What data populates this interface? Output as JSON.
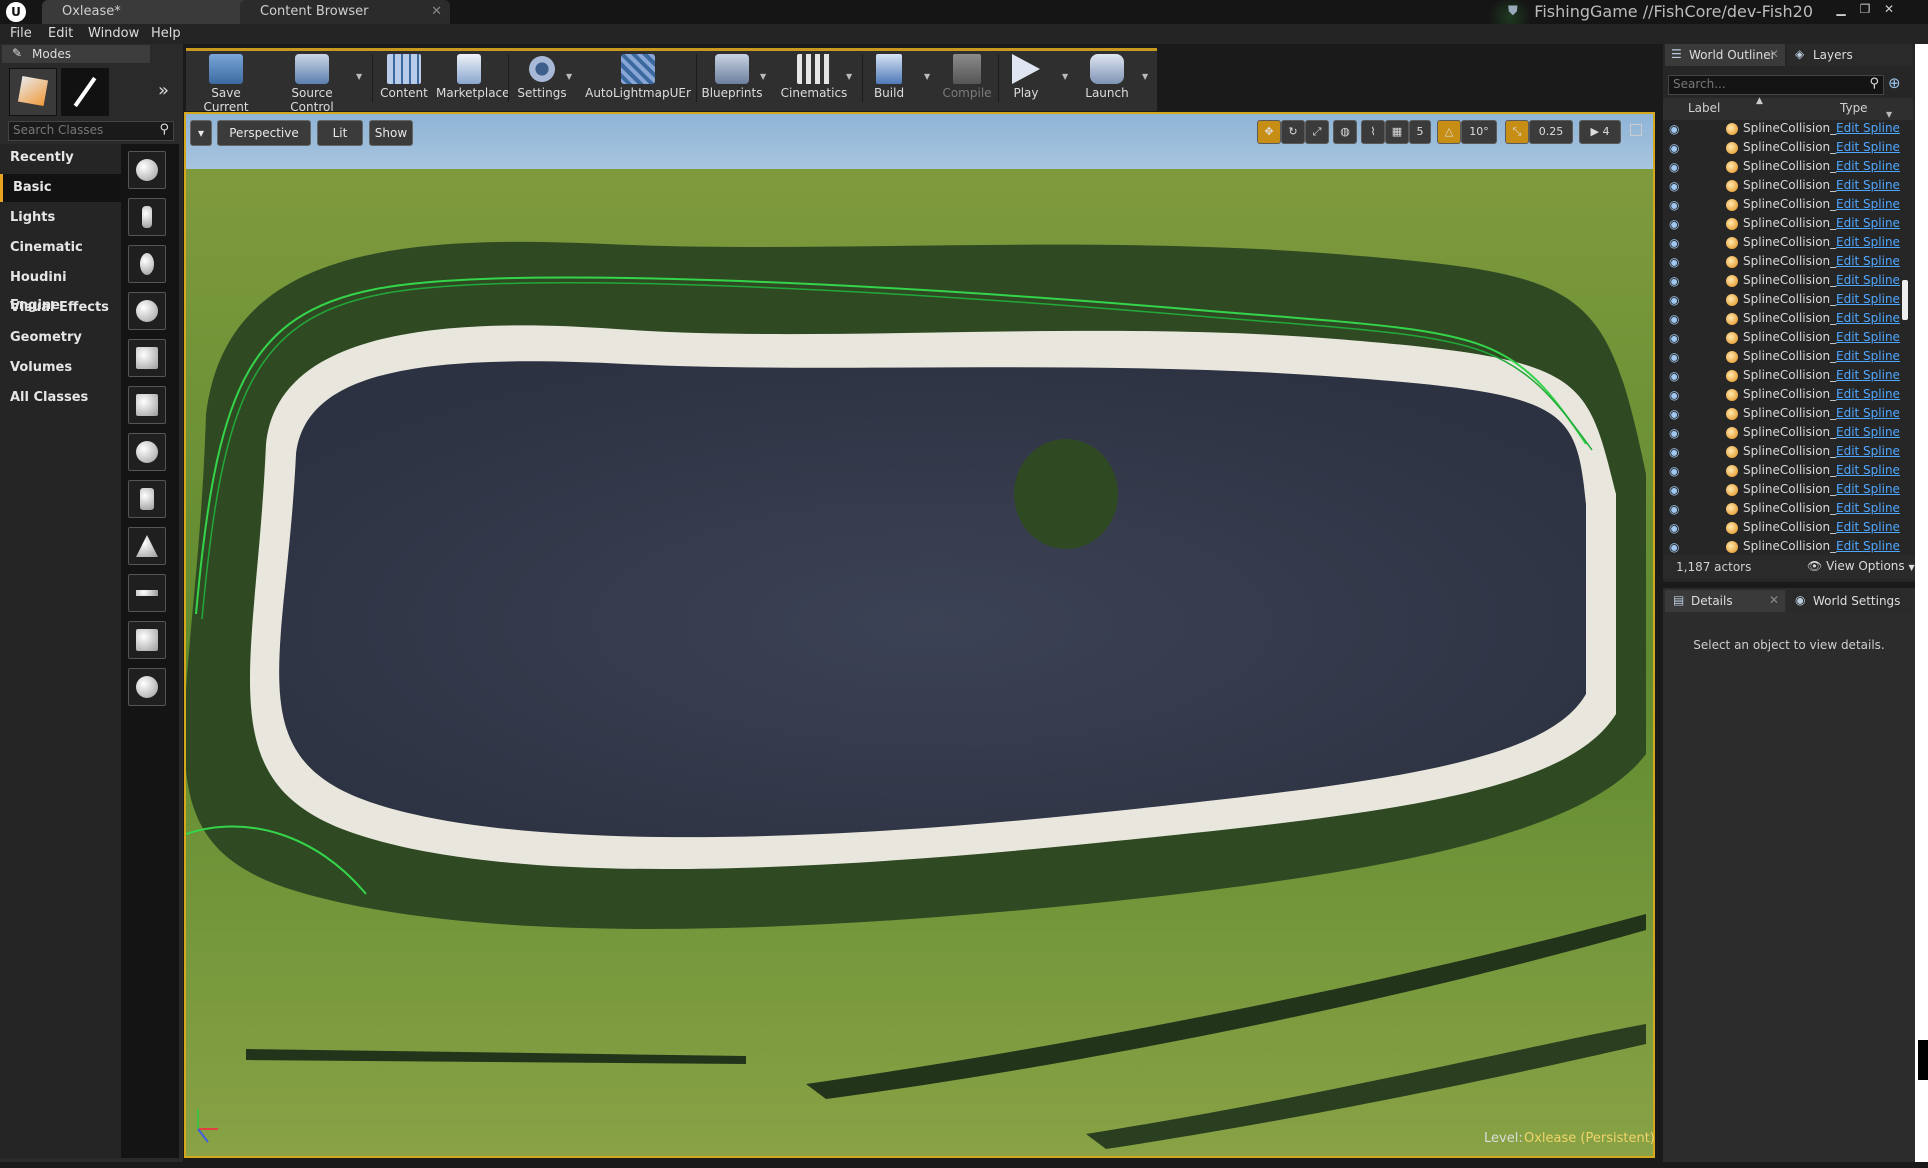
{
  "titlebar": {
    "logo": "U",
    "tabs": [
      {
        "label": "Oxlease*"
      },
      {
        "label": "Content Browser"
      }
    ],
    "project": "FishingGame //FishCore/dev-Fish20",
    "window_controls": [
      "minimize-icon",
      "restore-icon",
      "close-icon"
    ]
  },
  "menu": {
    "items": [
      "File",
      "Edit",
      "Window",
      "Help"
    ]
  },
  "modes": {
    "tab_label": "Modes",
    "search_placeholder": "Search Classes",
    "categories": [
      "Recently Placed",
      "Basic",
      "Lights",
      "Cinematic",
      "Houdini Engine",
      "Visual Effects",
      "Geometry",
      "Volumes",
      "All Classes"
    ],
    "selected": "Basic"
  },
  "toolbar": {
    "buttons": [
      "Save Current",
      "Source Control",
      "Content",
      "Marketplace",
      "Settings",
      "AutoLightmapUEr",
      "Blueprints",
      "Cinematics",
      "Build",
      "Compile",
      "Play",
      "Launch"
    ]
  },
  "viewport": {
    "view_mode": "Perspective",
    "lighting": "Lit",
    "show": "Show",
    "grid_snap": "5",
    "rotation_snap": "10°",
    "scale_snap": "0.25",
    "camera_speed": "4",
    "level_label": "Level:",
    "level_name": "Oxlease (Persistent)"
  },
  "outliner": {
    "tab_label": "World Outliner",
    "layers_label": "Layers",
    "search_placeholder": "Search...",
    "col_label": "Label",
    "col_type": "Type",
    "row_label": "SplineCollision_",
    "row_link": "Edit Spline",
    "row_count": 23,
    "actor_count": "1,187 actors",
    "view_options": "View Options"
  },
  "details": {
    "tab_label": "Details",
    "world_settings_label": "World Settings",
    "empty_text": "Select an object to view details."
  },
  "colors": {
    "accent": "#d4a71c",
    "link": "#4fa7ff",
    "water": "#33394a",
    "grass": "#6f8f34"
  }
}
